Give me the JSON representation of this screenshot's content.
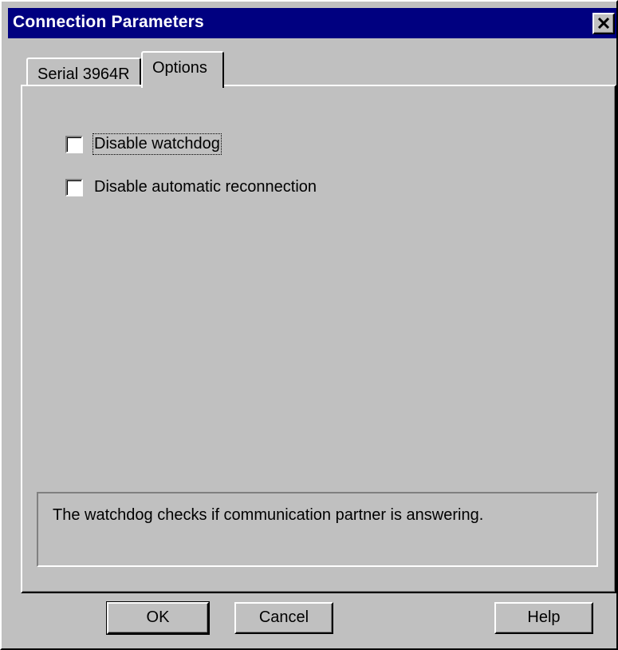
{
  "window": {
    "title": "Connection Parameters",
    "close_icon": "close-icon"
  },
  "tabs": [
    {
      "label": "Serial 3964R",
      "active": false
    },
    {
      "label": "Options",
      "active": true
    }
  ],
  "options": {
    "checkboxes": [
      {
        "label": "Disable watchdog",
        "checked": false,
        "focused": true
      },
      {
        "label": "Disable automatic reconnection",
        "checked": false,
        "focused": false
      }
    ],
    "description": "The watchdog checks if communication partner is answering."
  },
  "buttons": {
    "ok": "OK",
    "cancel": "Cancel",
    "help": "Help"
  },
  "colors": {
    "titlebar": "#000080",
    "face": "#c0c0c0"
  }
}
